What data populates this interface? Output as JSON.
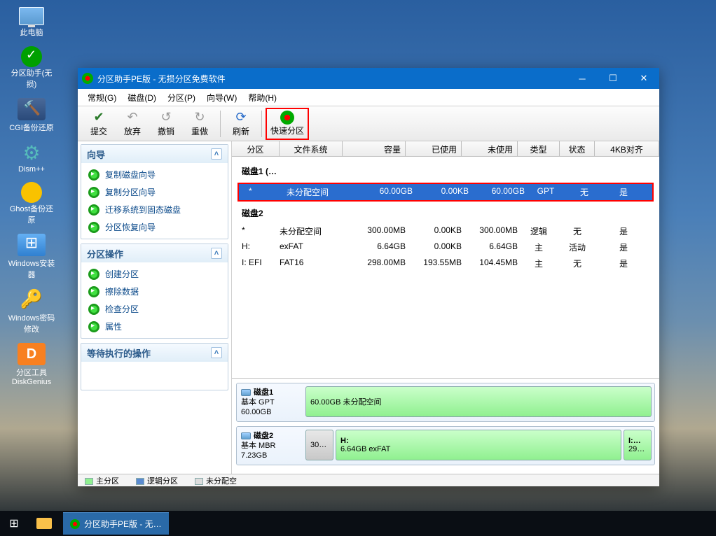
{
  "desktop": [
    {
      "label": "此电脑",
      "iconClass": "monitor"
    },
    {
      "label": "分区助手(无损)",
      "iconClass": "app-green"
    },
    {
      "label": "CGI备份还原",
      "iconClass": "hammer"
    },
    {
      "label": "Dism++",
      "iconClass": "gear"
    },
    {
      "label": "Ghost备份还原",
      "iconClass": "ghost"
    },
    {
      "label": "Windows安装器",
      "iconClass": "windows"
    },
    {
      "label": "Windows密码修改",
      "iconClass": "key"
    },
    {
      "label": "分区工具DiskGenius",
      "iconClass": "disk-app"
    }
  ],
  "window": {
    "title": "分区助手PE版 - 无损分区免费软件",
    "menus": [
      "常规(G)",
      "磁盘(D)",
      "分区(P)",
      "向导(W)",
      "帮助(H)"
    ],
    "toolbar": {
      "commit": "提交",
      "discard": "放弃",
      "undo": "撤销",
      "redo": "重做",
      "refresh": "刷新",
      "quick": "快速分区"
    },
    "panels": {
      "wizard": {
        "title": "向导",
        "items": [
          "复制磁盘向导",
          "复制分区向导",
          "迁移系统到固态磁盘",
          "分区恢复向导"
        ]
      },
      "ops": {
        "title": "分区操作",
        "items": [
          "创建分区",
          "擦除数据",
          "检查分区",
          "属性"
        ]
      },
      "pending": {
        "title": "等待执行的操作"
      }
    },
    "columns": [
      "分区",
      "文件系统",
      "容量",
      "已使用",
      "未使用",
      "类型",
      "状态",
      "4KB对齐"
    ],
    "disk1": {
      "label": "磁盘1 (…",
      "rows": [
        {
          "part": "*",
          "fs": "未分配空间",
          "size": "60.00GB",
          "used": "0.00KB",
          "free": "60.00GB",
          "type": "GPT",
          "status": "无",
          "align": "是"
        }
      ]
    },
    "disk2": {
      "label": "磁盘2",
      "rows": [
        {
          "part": "*",
          "fs": "未分配空间",
          "size": "300.00MB",
          "used": "0.00KB",
          "free": "300.00MB",
          "type": "逻辑",
          "status": "无",
          "align": "是"
        },
        {
          "part": "H:",
          "fs": "exFAT",
          "size": "6.64GB",
          "used": "0.00KB",
          "free": "6.64GB",
          "type": "主",
          "status": "活动",
          "align": "是"
        },
        {
          "part": "I: EFI",
          "fs": "FAT16",
          "size": "298.00MB",
          "used": "193.55MB",
          "free": "104.45MB",
          "type": "主",
          "status": "无",
          "align": "是"
        }
      ]
    },
    "diskmap": {
      "d1": {
        "name": "磁盘1",
        "scheme": "基本 GPT",
        "size": "60.00GB",
        "bar": "60.00GB 未分配空间"
      },
      "d2": {
        "name": "磁盘2",
        "scheme": "基本 MBR",
        "size": "7.23GB",
        "p1": "30…",
        "p2a": "H:",
        "p2b": "6.64GB exFAT",
        "p3a": "I:…",
        "p3b": "29…"
      }
    },
    "legend": {
      "primary": "主分区",
      "logical": "逻辑分区",
      "unalloc": "未分配空"
    }
  },
  "taskbar": {
    "active": "分区助手PE版 - 无…"
  }
}
